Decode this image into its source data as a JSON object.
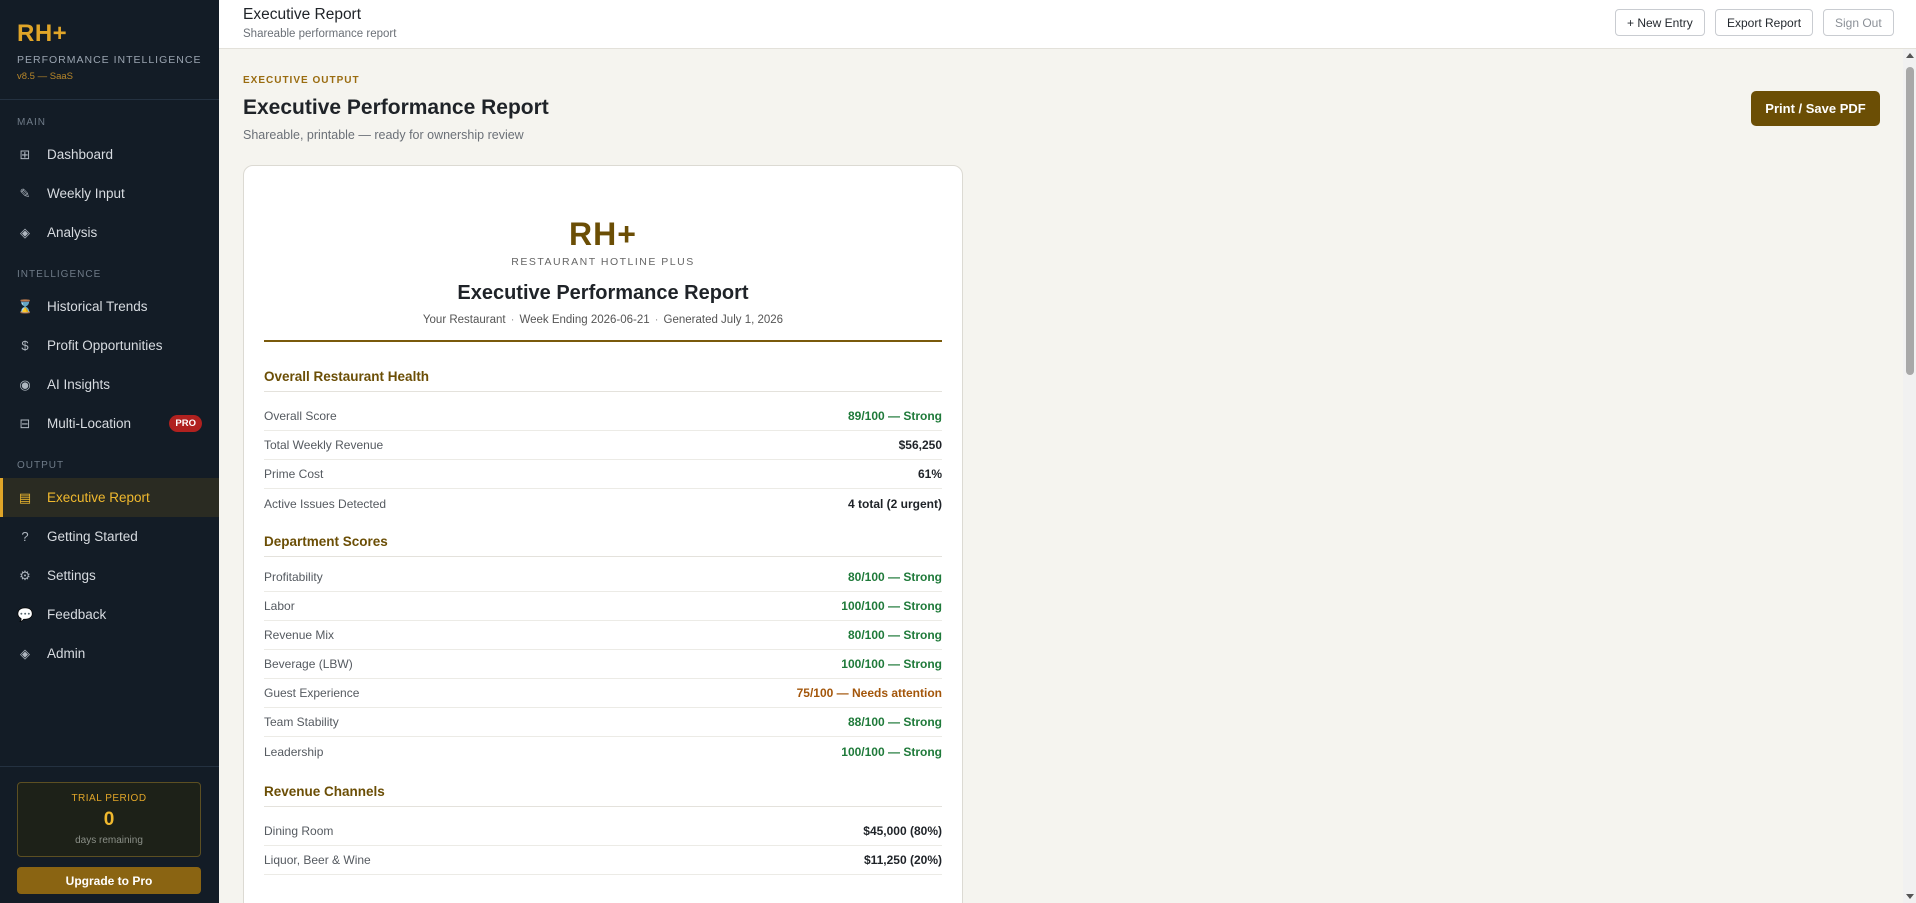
{
  "sidebar": {
    "logo": "RH+",
    "subtitle": "PERFORMANCE INTELLIGENCE",
    "version": "v8.5 — SaaS",
    "sections": {
      "main": "MAIN",
      "intelligence": "INTELLIGENCE",
      "output": "OUTPUT"
    },
    "items": [
      {
        "label": "Dashboard",
        "icon": "grid-icon"
      },
      {
        "label": "Weekly Input",
        "icon": "pencil-icon"
      },
      {
        "label": "Analysis",
        "icon": "diamond-icon"
      },
      {
        "label": "Historical Trends",
        "icon": "hourglass-icon"
      },
      {
        "label": "Profit Opportunities",
        "icon": "dollar-icon"
      },
      {
        "label": "AI Insights",
        "icon": "target-icon"
      },
      {
        "label": "Multi-Location",
        "icon": "building-icon",
        "badge": "PRO"
      },
      {
        "label": "Executive Report",
        "icon": "report-icon",
        "active": true
      },
      {
        "label": "Getting Started",
        "icon": "question-icon"
      },
      {
        "label": "Settings",
        "icon": "gear-icon"
      },
      {
        "label": "Feedback",
        "icon": "chat-icon"
      },
      {
        "label": "Admin",
        "icon": "diamond-icon"
      }
    ],
    "trial": {
      "label": "TRIAL PERIOD",
      "days": "0",
      "days_label": "days remaining"
    },
    "upgrade_label": "Upgrade to Pro"
  },
  "topbar": {
    "title": "Executive Report",
    "subtitle": "Shareable performance report",
    "new_entry": "+ New Entry",
    "export": "Export Report",
    "sign_out": "Sign Out"
  },
  "header": {
    "eyebrow": "EXECUTIVE OUTPUT",
    "title": "Executive Performance Report",
    "subtitle": "Shareable, printable — ready for ownership review",
    "print_label": "Print / Save PDF"
  },
  "report": {
    "logo": "RH+",
    "org": "RESTAURANT HOTLINE PLUS",
    "title": "Executive Performance Report",
    "restaurant": "Your Restaurant",
    "week": "Week Ending 2026-06-21",
    "generated": "Generated July 1, 2026",
    "health": {
      "title": "Overall Restaurant Health",
      "rows": [
        {
          "label": "Overall Score",
          "value": "89/100 — Strong"
        },
        {
          "label": "Total Weekly Revenue",
          "value": "$56,250"
        },
        {
          "label": "Prime Cost",
          "value": "61%"
        },
        {
          "label": "Active Issues Detected",
          "value": "4 total (2 urgent)"
        }
      ]
    },
    "departments": {
      "title": "Department Scores",
      "rows": [
        {
          "label": "Profitability",
          "value": "80/100 — Strong"
        },
        {
          "label": "Labor",
          "value": "100/100 — Strong"
        },
        {
          "label": "Revenue Mix",
          "value": "80/100 — Strong"
        },
        {
          "label": "Beverage (LBW)",
          "value": "100/100 — Strong"
        },
        {
          "label": "Guest Experience",
          "value": "75/100 — Needs attention"
        },
        {
          "label": "Team Stability",
          "value": "88/100 — Strong"
        },
        {
          "label": "Leadership",
          "value": "100/100 — Strong"
        }
      ]
    },
    "channels": {
      "title": "Revenue Channels",
      "rows": [
        {
          "label": "Dining Room",
          "value": "$45,000 (80%)"
        },
        {
          "label": "Liquor, Beer & Wine",
          "value": "$11,250 (20%)"
        }
      ]
    }
  },
  "colors": {
    "accent": "#e0a528",
    "brand_dark": "#6b4e05",
    "good": "#1f7a3a",
    "warn": "#a3560a",
    "sidebar_bg": "#131c26"
  }
}
